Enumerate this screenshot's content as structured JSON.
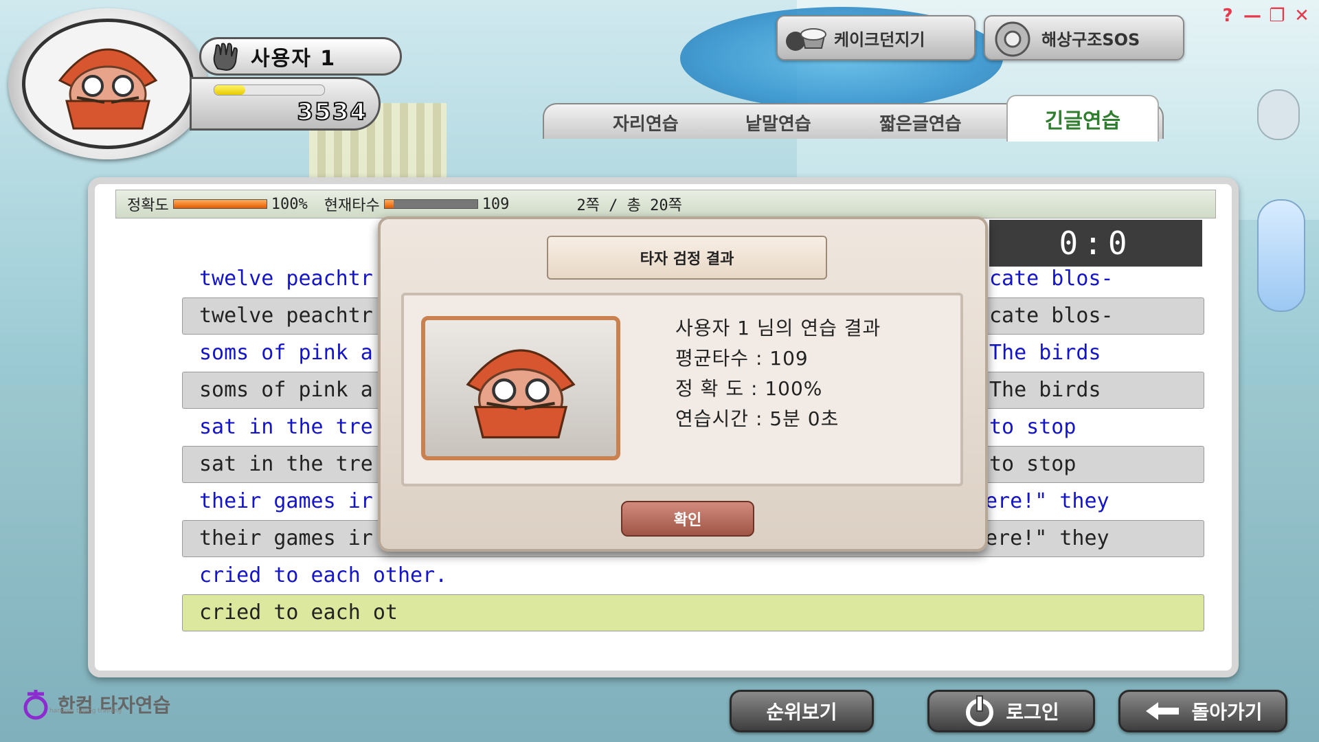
{
  "window_controls": {
    "help": "?",
    "minimize": "—",
    "restore": "❐",
    "close": "✕"
  },
  "user": {
    "name": "사용자 1",
    "score": "3534",
    "xp_fraction": 0.28
  },
  "top_buttons": {
    "cake": "케이크던지기",
    "rescue": "해상구조SOS"
  },
  "tabs": {
    "t1": "자리연습",
    "t2": "낱말연습",
    "t3": "짧은글연습",
    "t4": "긴글연습"
  },
  "stats": {
    "accuracy_label": "정확도",
    "accuracy_value": "100%",
    "accuracy_fraction": 1.0,
    "speed_label": "현재타수",
    "speed_value": "109",
    "speed_fraction": 0.1,
    "page": "2쪽 / 총 20쪽"
  },
  "score_box": "0:0",
  "lines": [
    {
      "left": "twelve peachtr",
      "right": "cate blos-"
    },
    {
      "left": "twelve peachtr",
      "right": "cate blos-"
    },
    {
      "left": "soms of pink a",
      "right": "The birds"
    },
    {
      "left": "soms of pink a",
      "right": "The birds"
    },
    {
      "left": "sat in the tre",
      "right": "to stop"
    },
    {
      "left": "sat in the tre",
      "right": "to stop"
    },
    {
      "left": "their games ir",
      "right": "ere!\" they"
    },
    {
      "left": "their games ir",
      "right": "ere!\" they"
    },
    {
      "left": "cried to each other.",
      "right": ""
    },
    {
      "left": "cried to each ot",
      "right": ""
    }
  ],
  "modal": {
    "title": "타자 검정 결과",
    "result_heading": "사용자 1 님의 연습 결과",
    "avg_speed": "평균타수 : 109",
    "accuracy": "정 확 도 : 100%",
    "time": "연습시간 : 5분 0초",
    "confirm": "확인"
  },
  "logo": {
    "text": "한컴 타자연습",
    "sub": "hancom typing training"
  },
  "bottom_buttons": {
    "ranking": "순위보기",
    "login": "로그인",
    "back": "돌아가기"
  },
  "colors": {
    "source_text": "#1414c8",
    "active_tab": "#2f7d2f",
    "current_line": "#dbe89e"
  }
}
